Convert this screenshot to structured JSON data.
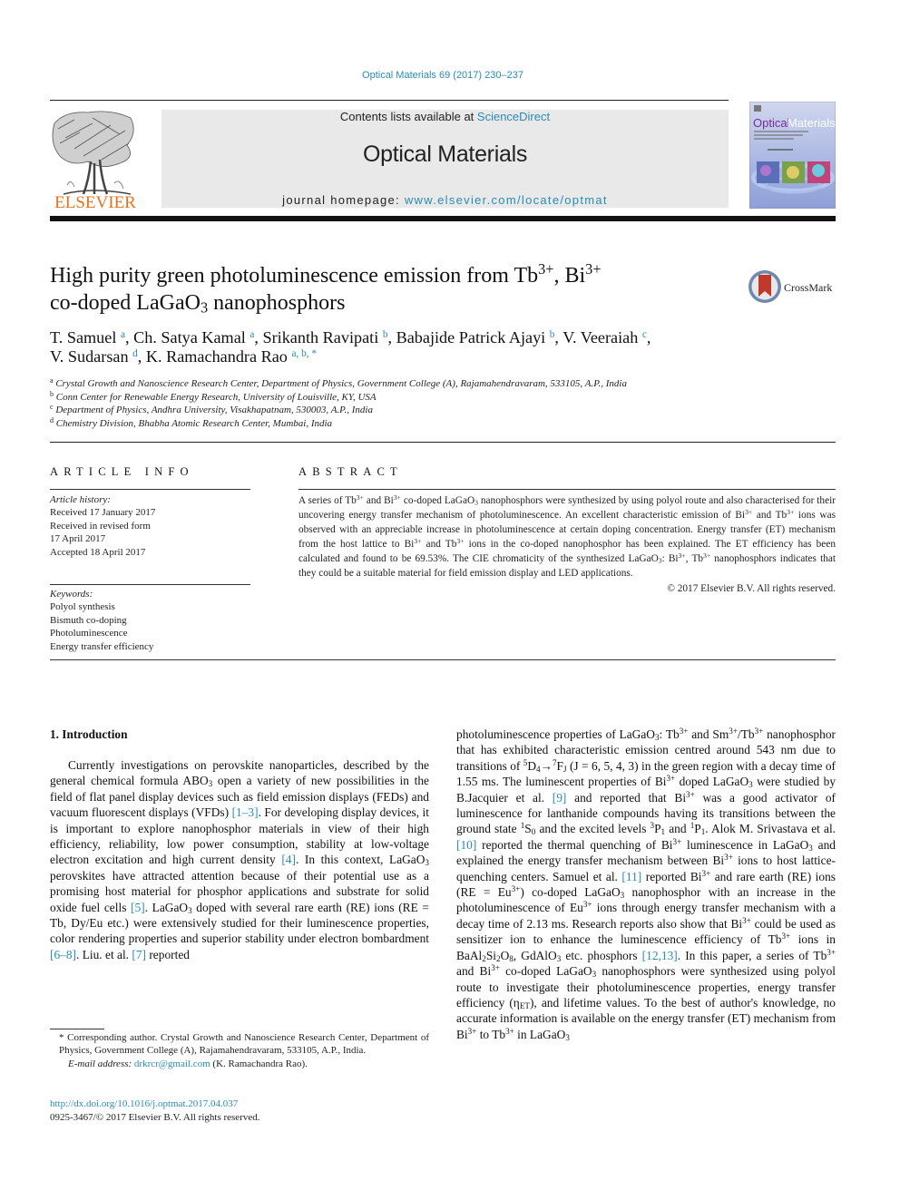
{
  "header": {
    "journal_ref": "Optical Materials 69 (2017) 230–237",
    "contents_prefix": "Contents lists available at ",
    "contents_link": "ScienceDirect",
    "journal_name": "Optical Materials",
    "homepage_prefix": "journal homepage: ",
    "homepage_link": "www.elsevier.com/locate/optmat",
    "publisher_logo_text": "ELSEVIER",
    "cover_title_part1": "Optical",
    "cover_title_part2": "Materials",
    "crossmark_label": "CrossMark",
    "colors": {
      "link": "#2a8bb5",
      "elsevier_orange": "#e9711c",
      "masthead_bg": "#e9e9e9"
    }
  },
  "article": {
    "title_part1": "High purity green photoluminescence emission from Tb",
    "title_sup1": "3+",
    "title_part2": ", Bi",
    "title_sup2": "3+",
    "title_part3": "co-doped LaGaO",
    "title_sub3": "3",
    "title_part4": " nanophosphors",
    "authors": [
      {
        "name": "T. Samuel",
        "aff": "a",
        "sep": ", "
      },
      {
        "name": "Ch. Satya Kamal",
        "aff": "a",
        "sep": ", "
      },
      {
        "name": "Srikanth Ravipati",
        "aff": "b",
        "sep": ", "
      },
      {
        "name": "Babajide Patrick Ajayi",
        "aff": "b",
        "sep": ", "
      },
      {
        "name": "V. Veeraiah",
        "aff": "c",
        "sep": ","
      },
      {
        "name": "V. Sudarsan",
        "aff": "d",
        "sep": ", "
      },
      {
        "name": "K. Ramachandra Rao",
        "aff": "a, b, *",
        "sep": ""
      }
    ],
    "affiliations": [
      {
        "key": "a",
        "text": "Crystal Growth and Nanoscience Research Center, Department of Physics, Government College (A), Rajamahendravaram, 533105, A.P., India"
      },
      {
        "key": "b",
        "text": "Conn Center for Renewable Energy Research, University of Louisville, KY, USA"
      },
      {
        "key": "c",
        "text": "Department of Physics, Andhra University, Visakhapatnam, 530003, A.P., India"
      },
      {
        "key": "d",
        "text": "Chemistry Division, Bhabha Atomic Research Center, Mumbai, India"
      }
    ]
  },
  "article_info": {
    "heading": "ARTICLE INFO",
    "history_label": "Article history:",
    "history": [
      "Received 17 January 2017",
      "Received in revised form",
      "17 April 2017",
      "Accepted 18 April 2017"
    ],
    "keywords_label": "Keywords:",
    "keywords": [
      "Polyol synthesis",
      "Bismuth co-doping",
      "Photoluminescence",
      "Energy transfer efficiency"
    ]
  },
  "abstract": {
    "heading": "ABSTRACT",
    "t1": "A series of Tb",
    "t2": " and Bi",
    "t3": " co-doped LaGaO",
    "t4": " nanophosphors were synthesized by using polyol route and also characterised for their uncovering energy transfer mechanism of photoluminescence. An excellent characteristic emission of Bi",
    "t5": " and Tb",
    "t6": " ions was observed with an appreciable increase in photoluminescence at certain doping concentration. Energy transfer (ET) mechanism from the host lattice to Bi",
    "t7": " and Tb",
    "t8": " ions in the co-doped nanophosphor has been explained. The ET efficiency has been calculated and found to be 69.53%. The CIE chromaticity of the synthesized LaGaO",
    "t9": ": Bi",
    "t10": ", Tb",
    "t11": " nanophosphors indicates that they could be a suitable material for field emission display and LED applications.",
    "sup": "3+",
    "sub": "3",
    "copyright": "© 2017 Elsevier B.V. All rights reserved."
  },
  "intro": {
    "heading": "1.  Introduction",
    "left": {
      "a1": "Currently investigations on perovskite nanoparticles, described by the general chemical formula ABO",
      "a2": " open a variety of new possibilities in the field of flat panel display devices such as field emission displays (FEDs) and vacuum fluorescent displays (VFDs) ",
      "c1": "[1–3]",
      "a3": ". For developing display devices, it is important to explore nanophosphor materials in view of their high efficiency, reliability, low power consumption, stability at low-voltage electron excitation and high current density ",
      "c2": "[4]",
      "a4": ". In this context, LaGaO",
      "a5": " perovskites have attracted attention because of their potential use as a promising host material for phosphor applications and substrate for solid oxide fuel cells ",
      "c3": "[5]",
      "a6": ". LaGaO",
      "a7": " doped with several rare earth (RE) ions (RE = Tb, Dy/Eu etc.) were extensively studied for their luminescence properties, color rendering properties and superior stability under electron bombardment ",
      "c4": "[6–8]",
      "a8": ". Liu. et al. ",
      "c5": "[7]",
      "a9": " reported"
    },
    "right": {
      "b1": "photoluminescence properties of LaGaO",
      "b2": ": Tb",
      "b3": " and Sm",
      "b4": "/Tb",
      "b5": " nanophosphor that has exhibited characteristic emission centred around 543 nm due to transitions of ",
      "b5sup": "5",
      "b6": "D",
      "b6sub": "4",
      "b7": "→",
      "b7sup": "7",
      "b8": "F",
      "b8sub": "J",
      "b9": " (J = 6, 5, 4, 3) in the green region with a decay time of 1.55 ms. The luminescent properties of Bi",
      "b10": " doped LaGaO",
      "b11": " were studied by B.Jacquier et al. ",
      "c9": "[9]",
      "b12": " and reported that Bi",
      "b13": " was a good activator of luminescence for lanthanide compounds having its transitions between the ground state ",
      "b13sup": "1",
      "b14": "S",
      "b14sub": "0",
      "b15": " and the excited levels ",
      "b15sup": "3",
      "b16": "P",
      "b16sub": "1",
      "b17": " and ",
      "b17sup": "1",
      "b18": "P",
      "b18sub": "1",
      "b19": ". Alok M. Srivastava et al. ",
      "c10": "[10]",
      "b20": " reported the thermal quenching of Bi",
      "b21": " luminescence in LaGaO",
      "b22": " and explained the energy transfer mechanism between Bi",
      "b23": " ions to host lattice-quenching centers. Samuel et al. ",
      "c11": "[11]",
      "b24": " reported Bi",
      "b25": " and rare earth (RE) ions (RE = Eu",
      "b26": ") co-doped LaGaO",
      "b27": " nanophosphor with an increase in the photoluminescence of Eu",
      "b28": " ions through energy transfer mechanism with a decay time of 2.13 ms. Research reports also show that Bi",
      "b29": " could be used as sensitizer ion to enhance the luminescence efficiency of Tb",
      "b30": " ions in BaAl",
      "b30sub": "2",
      "b31": "Si",
      "b31sub": "2",
      "b32": "O",
      "b32sub": "8",
      "b33": ", GdAlO",
      "b34": " etc. phosphors ",
      "c12": "[12,13]",
      "b35": ". In this paper, a series of Tb",
      "b36": " and Bi",
      "b37": " co-doped LaGaO",
      "b38": " nanophosphors were synthesized using polyol route to investigate their photoluminescence properties, energy transfer efficiency (η",
      "b38sub": "ET",
      "b39": "), and lifetime values. To the best of author's knowledge, no accurate information is available on the energy transfer (ET) mechanism from Bi",
      "b40": " to Tb",
      "b41": " in LaGaO",
      "sup": "3+",
      "sub": "3"
    }
  },
  "footnote": {
    "corresponding": "* Corresponding author. Crystal Growth and Nanoscience Research Center, Department of Physics, Government College (A), Rajamahendravaram, 533105, A.P., India.",
    "email_label": "E-mail address: ",
    "email": "drkrcr@gmail.com",
    "email_owner": " (K. Ramachandra Rao).",
    "doi": "http://dx.doi.org/10.1016/j.optmat.2017.04.037",
    "issn": "0925-3467/© 2017 Elsevier B.V. All rights reserved."
  }
}
